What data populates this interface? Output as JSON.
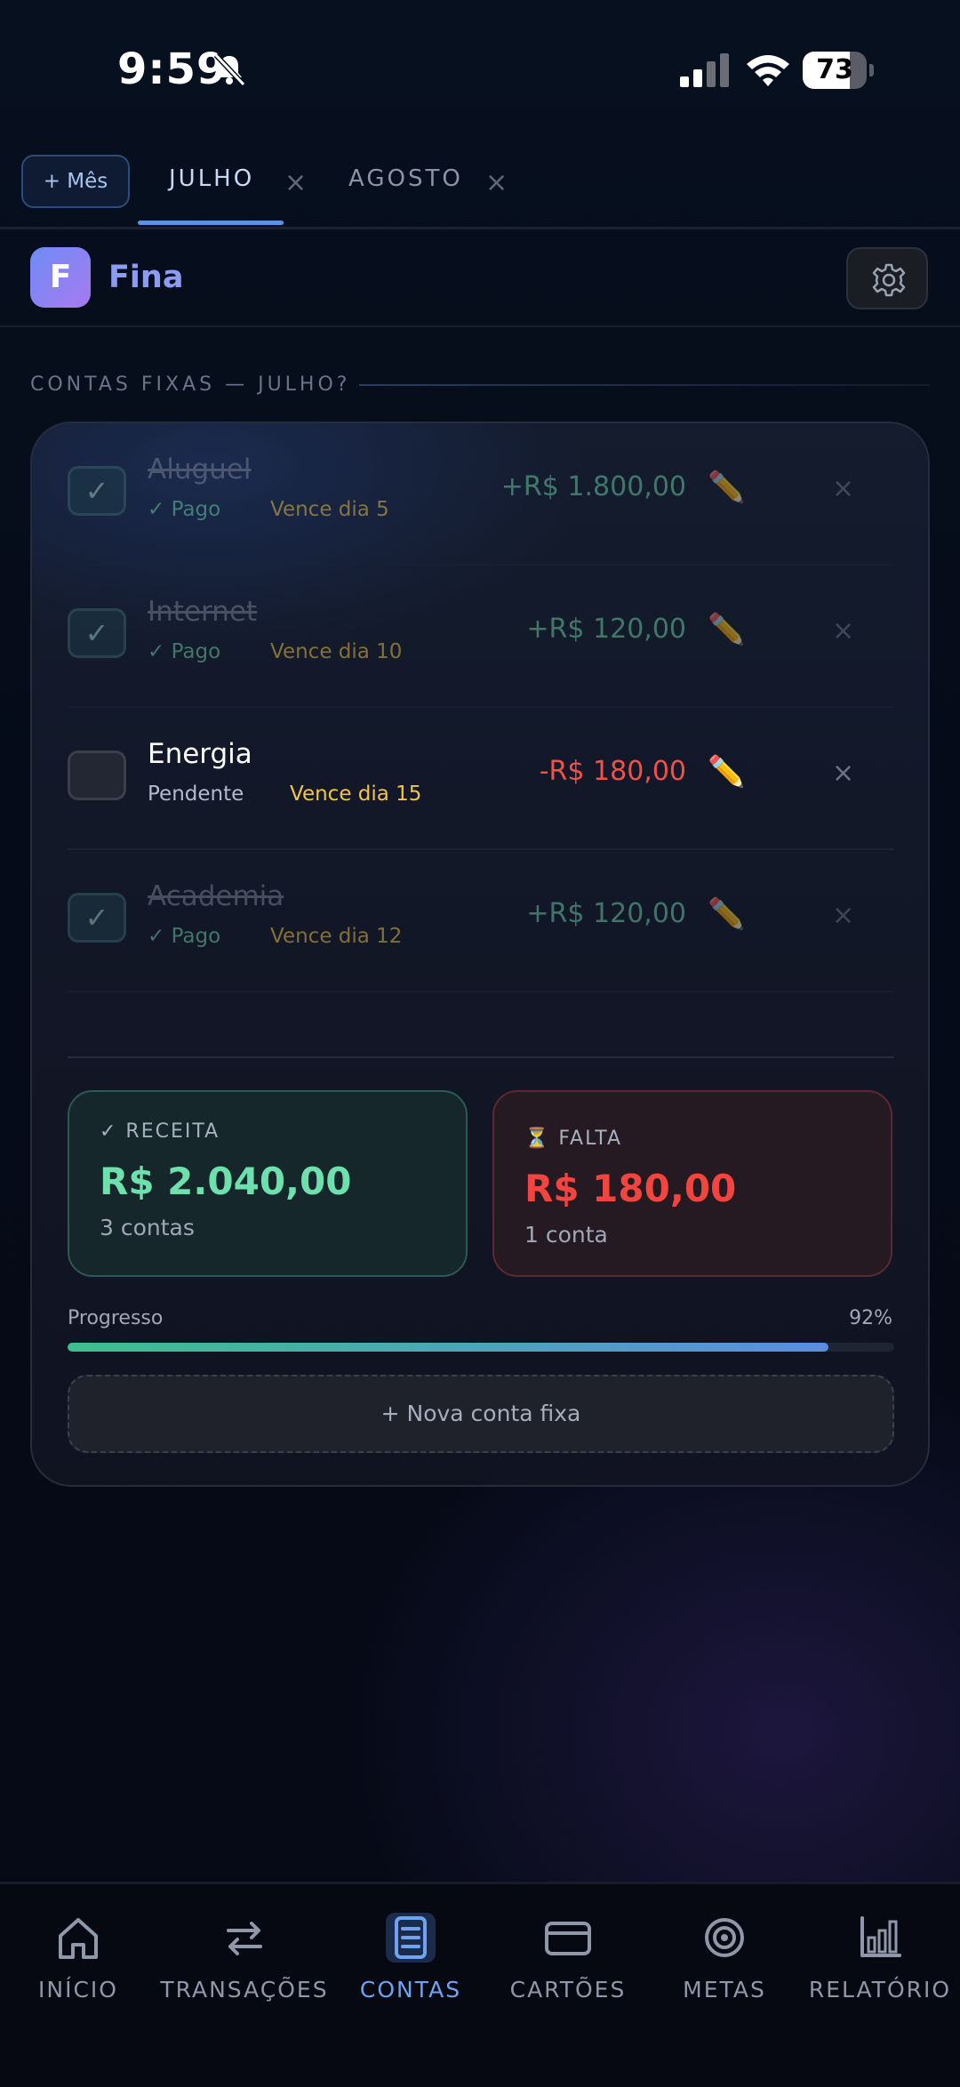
{
  "status_bar": {
    "time": "9:59",
    "battery_percent": 73,
    "battery_text": "73"
  },
  "month_tabs": {
    "add_label": "+ Mês",
    "tabs": [
      {
        "label": "JULHO",
        "active": true
      },
      {
        "label": "AGOSTO",
        "active": false
      }
    ],
    "close_glyph": "×"
  },
  "header": {
    "logo_letter": "F",
    "app_name": "Fina",
    "settings_icon": "gear-icon"
  },
  "section": {
    "title": "CONTAS FIXAS — JULHO?"
  },
  "bills": [
    {
      "name": "Aluguel",
      "status": "✓ Pago",
      "due": "Vence dia 5",
      "amount": "+R$ 1.800,00",
      "paid": true,
      "check": "✓"
    },
    {
      "name": "Internet",
      "status": "✓ Pago",
      "due": "Vence dia 10",
      "amount": "+R$ 120,00",
      "paid": true,
      "check": "✓"
    },
    {
      "name": "Energia",
      "status": "Pendente",
      "due": "Vence dia 15",
      "amount": "-R$ 180,00",
      "paid": false,
      "check": ""
    },
    {
      "name": "Academia",
      "status": "✓ Pago",
      "due": "Vence dia 12",
      "amount": "+R$ 120,00",
      "paid": true,
      "check": "✓"
    }
  ],
  "bill_actions": {
    "edit_glyph": "✏️",
    "delete_glyph": "×"
  },
  "summary": {
    "receita": {
      "label": "✓ RECEITA",
      "value": "R$ 2.040,00",
      "sub": "3 contas"
    },
    "falta": {
      "label": "⏳ FALTA",
      "value": "R$ 180,00",
      "sub": "1 conta"
    }
  },
  "progress": {
    "label": "Progresso",
    "percent_text": "92%",
    "percent": 92
  },
  "new_bill_label": "+ Nova conta fixa",
  "bottom_nav": [
    {
      "label": "INÍCIO",
      "icon": "home-icon"
    },
    {
      "label": "TRANSAÇÕES",
      "icon": "transfer-icon"
    },
    {
      "label": "CONTAS",
      "icon": "document-icon",
      "active": true
    },
    {
      "label": "CARTÕES",
      "icon": "card-icon"
    },
    {
      "label": "METAS",
      "icon": "target-icon"
    },
    {
      "label": "RELATÓRIO",
      "icon": "chart-icon"
    }
  ],
  "colors": {
    "accent": "#6fa3f0",
    "positive": "#6fd1a8",
    "negative": "#f2504a",
    "due": "#f0c44b"
  }
}
